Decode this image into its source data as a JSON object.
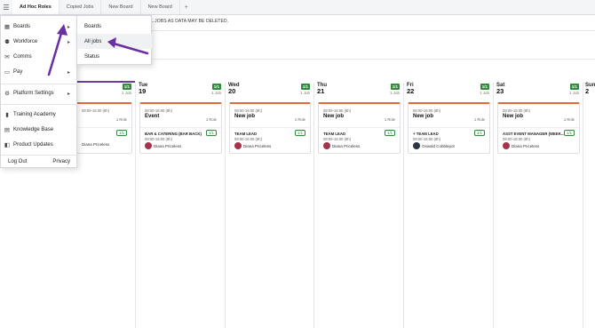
{
  "tabs": [
    "Ad Hoc Roles",
    "Copied Jobs",
    "New Board",
    "New Board"
  ],
  "tab_add": "+",
  "warning": "L JOBS AS DATA MAY BE DELETED.",
  "menu": {
    "items": [
      {
        "label": "Boards",
        "icon": "boards-icon",
        "chevron": "▸"
      },
      {
        "label": "Workforce",
        "icon": "workforce-icon",
        "chevron": "▸"
      },
      {
        "label": "Comms",
        "icon": "comms-icon",
        "chevron": ""
      },
      {
        "label": "Pay",
        "icon": "pay-icon",
        "chevron": "▸"
      },
      {
        "label": "Platform Settings",
        "icon": "settings-icon",
        "chevron": "▸"
      },
      {
        "label": "Training Academy",
        "icon": "training-icon",
        "chevron": ""
      },
      {
        "label": "Knowledge Base",
        "icon": "knowledge-icon",
        "chevron": ""
      },
      {
        "label": "Product Updates",
        "icon": "updates-icon",
        "chevron": ""
      }
    ],
    "logout": "Log Out",
    "privacy": "Privacy"
  },
  "submenu": [
    "Boards",
    "All jobs",
    "Status"
  ],
  "days": [
    {
      "name": "",
      "num": "",
      "badge": "1/1",
      "jobs": "1 Job"
    },
    {
      "name": "Tue",
      "num": "19",
      "badge": "1/1",
      "jobs": "1 Job"
    },
    {
      "name": "Wed",
      "num": "20",
      "badge": "1/1",
      "jobs": "1 Job"
    },
    {
      "name": "Thu",
      "num": "21",
      "badge": "1/1",
      "jobs": "1 Job"
    },
    {
      "name": "Fri",
      "num": "22",
      "badge": "1/1",
      "jobs": "1 Job"
    },
    {
      "name": "Sat",
      "num": "23",
      "badge": "1/1",
      "jobs": "1 Job"
    },
    {
      "name": "Sun",
      "num": "2",
      "badge": "",
      "jobs": ""
    }
  ],
  "cards": [
    {
      "time": "08:00-16:00 (8h)",
      "title": "",
      "roles": "1 Role",
      "role": "",
      "role_badge": "1/1",
      "shift": "",
      "person": "Diana Priceless",
      "avatar": "red"
    },
    {
      "time": "08:00-16:00 (8h)",
      "title": "Event",
      "roles": "1 Role",
      "role": "BAR & CATERING (BAR BACK)",
      "role_badge": "1/1",
      "shift": "08:00-16:00 (8h)",
      "person": "Diana Priceless",
      "avatar": "red"
    },
    {
      "time": "08:00-16:00 (8h)",
      "title": "New job",
      "roles": "1 Role",
      "role": "TEAM LEAD",
      "role_badge": "1/1",
      "shift": "08:00-16:00 (8h)",
      "person": "Diana Priceless",
      "avatar": "red"
    },
    {
      "time": "08:00-16:00 (8h)",
      "title": "New job",
      "roles": "1 Role",
      "role": "TEAM LEAD",
      "role_badge": "1/1",
      "shift": "08:00-16:00 (8h)",
      "person": "Diana Priceless",
      "avatar": "red"
    },
    {
      "time": "08:00-16:00 (8h)",
      "title": "New job",
      "roles": "1 Role",
      "role": "+ TEAM LEAD",
      "role_badge": "1/1",
      "shift": "08:00-16:00 (8h)",
      "person": "Oswald Cobblepot",
      "avatar": "dark"
    },
    {
      "time": "08:00-16:00 (8h)",
      "title": "New job",
      "roles": "1 Role",
      "role": "ASST EVENT MANAGER (WEEK...",
      "role_badge": "1/1",
      "shift": "08:00-16:00 (8h)",
      "person": "Diana Priceless",
      "avatar": "red"
    }
  ],
  "colors": {
    "accent": "#6b3fa0",
    "badge_green": "#2f8a3a",
    "card_top": "#e36a3a",
    "arrow": "#6a2fa3"
  }
}
